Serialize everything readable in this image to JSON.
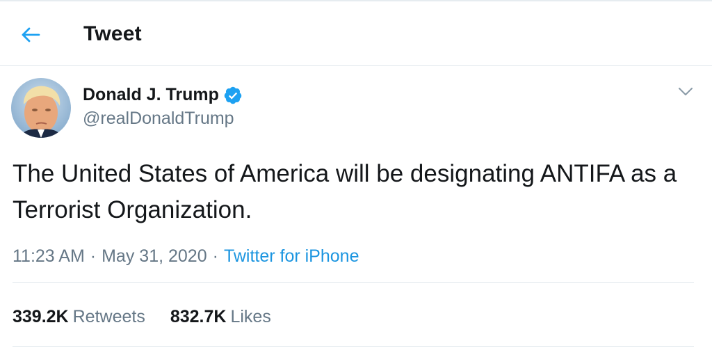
{
  "header": {
    "title": "Tweet",
    "back_icon": "arrow-left-icon"
  },
  "author": {
    "name": "Donald J. Trump",
    "handle": "@realDonaldTrump",
    "verified_icon": "verified-badge-icon"
  },
  "tweet": {
    "text": "The United States of America will be designating ANTIFA as a Terrorist Organization.",
    "time": "11:23 AM",
    "date": "May 31, 2020",
    "separator": "·",
    "source": "Twitter for iPhone"
  },
  "stats": {
    "retweets_count": "339.2K",
    "retweets_label": "Retweets",
    "likes_count": "832.7K",
    "likes_label": "Likes"
  },
  "colors": {
    "accent": "#1da1f2",
    "link": "#1b95e0",
    "secondary_text": "#657786",
    "primary_text": "#14171a",
    "divider": "#e1e8ed"
  }
}
